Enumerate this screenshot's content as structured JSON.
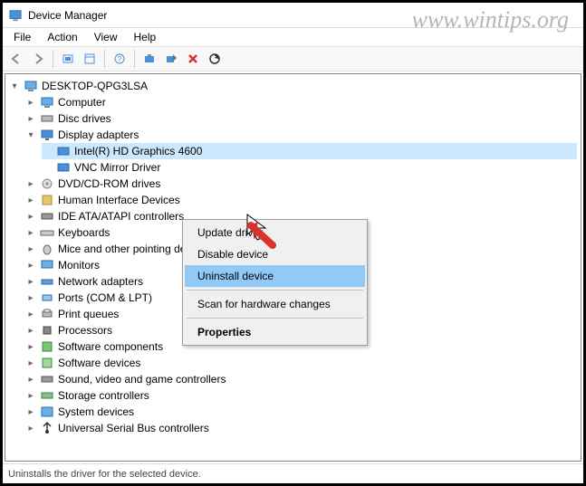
{
  "watermark": "www.wintips.org",
  "window": {
    "title": "Device Manager"
  },
  "menu": {
    "file": "File",
    "action": "Action",
    "view": "View",
    "help": "Help"
  },
  "toolbar_icons": {
    "back": "back-icon",
    "forward": "forward-icon",
    "show_hidden": "show-hidden-icon",
    "properties": "properties-icon",
    "refresh": "refresh-icon",
    "help": "help-icon",
    "update": "update-driver-icon",
    "enable": "enable-device-icon",
    "uninstall": "uninstall-icon",
    "scan": "scan-hardware-icon"
  },
  "tree": {
    "root": "DESKTOP-QPG3LSA",
    "nodes": [
      {
        "label": "Computer"
      },
      {
        "label": "Disc drives"
      },
      {
        "label": "Display adapters",
        "expanded": true,
        "children": [
          {
            "label": "Intel(R) HD Graphics 4600",
            "selected": true
          },
          {
            "label": "VNC Mirror Driver"
          }
        ]
      },
      {
        "label": "DVD/CD-ROM drives"
      },
      {
        "label": "Human Interface Devices"
      },
      {
        "label": "IDE ATA/ATAPI controllers"
      },
      {
        "label": "Keyboards"
      },
      {
        "label": "Mice and other pointing devices"
      },
      {
        "label": "Monitors"
      },
      {
        "label": "Network adapters"
      },
      {
        "label": "Ports (COM & LPT)"
      },
      {
        "label": "Print queues"
      },
      {
        "label": "Processors"
      },
      {
        "label": "Software components"
      },
      {
        "label": "Software devices"
      },
      {
        "label": "Sound, video and game controllers"
      },
      {
        "label": "Storage controllers"
      },
      {
        "label": "System devices"
      },
      {
        "label": "Universal Serial Bus controllers"
      }
    ]
  },
  "contextmenu": {
    "update": "Update driver",
    "disable": "Disable device",
    "uninstall": "Uninstall device",
    "scan": "Scan for hardware changes",
    "properties": "Properties"
  },
  "statusbar": {
    "text": "Uninstalls the driver for the selected device."
  }
}
